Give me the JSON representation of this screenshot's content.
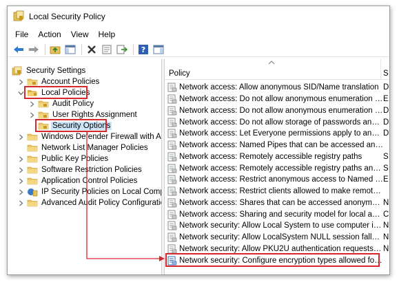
{
  "window": {
    "title": "Local Security Policy"
  },
  "menu": [
    "File",
    "Action",
    "View",
    "Help"
  ],
  "toolbar": [
    "back-icon",
    "forward-icon",
    "up-folder-icon",
    "show-hide-tree-icon",
    "delete-icon",
    "properties-icon",
    "export-list-icon",
    "help-icon",
    "action-pane-icon"
  ],
  "tree": [
    {
      "label": "Security Settings",
      "level": 0,
      "icon": "security-settings-icon",
      "chevron": ""
    },
    {
      "label": "Account Policies",
      "level": 1,
      "icon": "folder-icon",
      "chevron": ">"
    },
    {
      "label": "Local Policies",
      "level": 1,
      "icon": "folder-open-icon",
      "chevron": "v"
    },
    {
      "label": "Audit Policy",
      "level": 2,
      "icon": "folder-icon",
      "chevron": ">"
    },
    {
      "label": "User Rights Assignment",
      "level": 2,
      "icon": "folder-icon",
      "chevron": ">"
    },
    {
      "label": "Security Options",
      "level": 2,
      "icon": "folder-icon",
      "chevron": ""
    },
    {
      "label": "Windows Defender Firewall with Adva",
      "level": 1,
      "icon": "folder-icon",
      "chevron": ">"
    },
    {
      "label": "Network List Manager Policies",
      "level": 1,
      "icon": "folder-icon",
      "chevron": ""
    },
    {
      "label": "Public Key Policies",
      "level": 1,
      "icon": "folder-icon",
      "chevron": ">"
    },
    {
      "label": "Software Restriction Policies",
      "level": 1,
      "icon": "folder-icon",
      "chevron": ">"
    },
    {
      "label": "Application Control Policies",
      "level": 1,
      "icon": "folder-icon",
      "chevron": ">"
    },
    {
      "label": "IP Security Policies on Local Compute",
      "level": 1,
      "icon": "ip-security-icon",
      "chevron": ">"
    },
    {
      "label": "Advanced Audit Policy Configuration",
      "level": 1,
      "icon": "folder-icon",
      "chevron": ">"
    }
  ],
  "list": {
    "column_policy": "Policy",
    "column_second": "S",
    "rows": [
      {
        "text": "Network access: Allow anonymous SID/Name translation",
        "second": "D"
      },
      {
        "text": "Network access: Do not allow anonymous enumeration of S...",
        "second": "E"
      },
      {
        "text": "Network access: Do not allow anonymous enumeration of S...",
        "second": "D"
      },
      {
        "text": "Network access: Do not allow storage of passwords and cre...",
        "second": "D"
      },
      {
        "text": "Network access: Let Everyone permissions apply to anonym...",
        "second": "D"
      },
      {
        "text": "Network access: Named Pipes that can be accessed anonym...",
        "second": ""
      },
      {
        "text": "Network access: Remotely accessible registry paths",
        "second": "S"
      },
      {
        "text": "Network access: Remotely accessible registry paths and sub...",
        "second": "S"
      },
      {
        "text": "Network access: Restrict anonymous access to Named Pipes...",
        "second": "E"
      },
      {
        "text": "Network access: Restrict clients allowed to make remote call...",
        "second": ""
      },
      {
        "text": "Network access: Shares that can be accessed anonymously",
        "second": "N"
      },
      {
        "text": "Network access: Sharing and security model for local accou...",
        "second": "C"
      },
      {
        "text": "Network security: Allow Local System to use computer ident...",
        "second": "N"
      },
      {
        "text": "Network security: Allow LocalSystem NULL session fallback",
        "second": "N"
      },
      {
        "text": "Network security: Allow PKU2U authentication requests to t...",
        "second": "N"
      },
      {
        "text": "Network security: Configure encryption types allowed for Ke...",
        "second": ""
      }
    ]
  },
  "colors": {
    "highlight": "#d8262d",
    "selected": "#cce4f7",
    "folder": "#e8c15a"
  }
}
